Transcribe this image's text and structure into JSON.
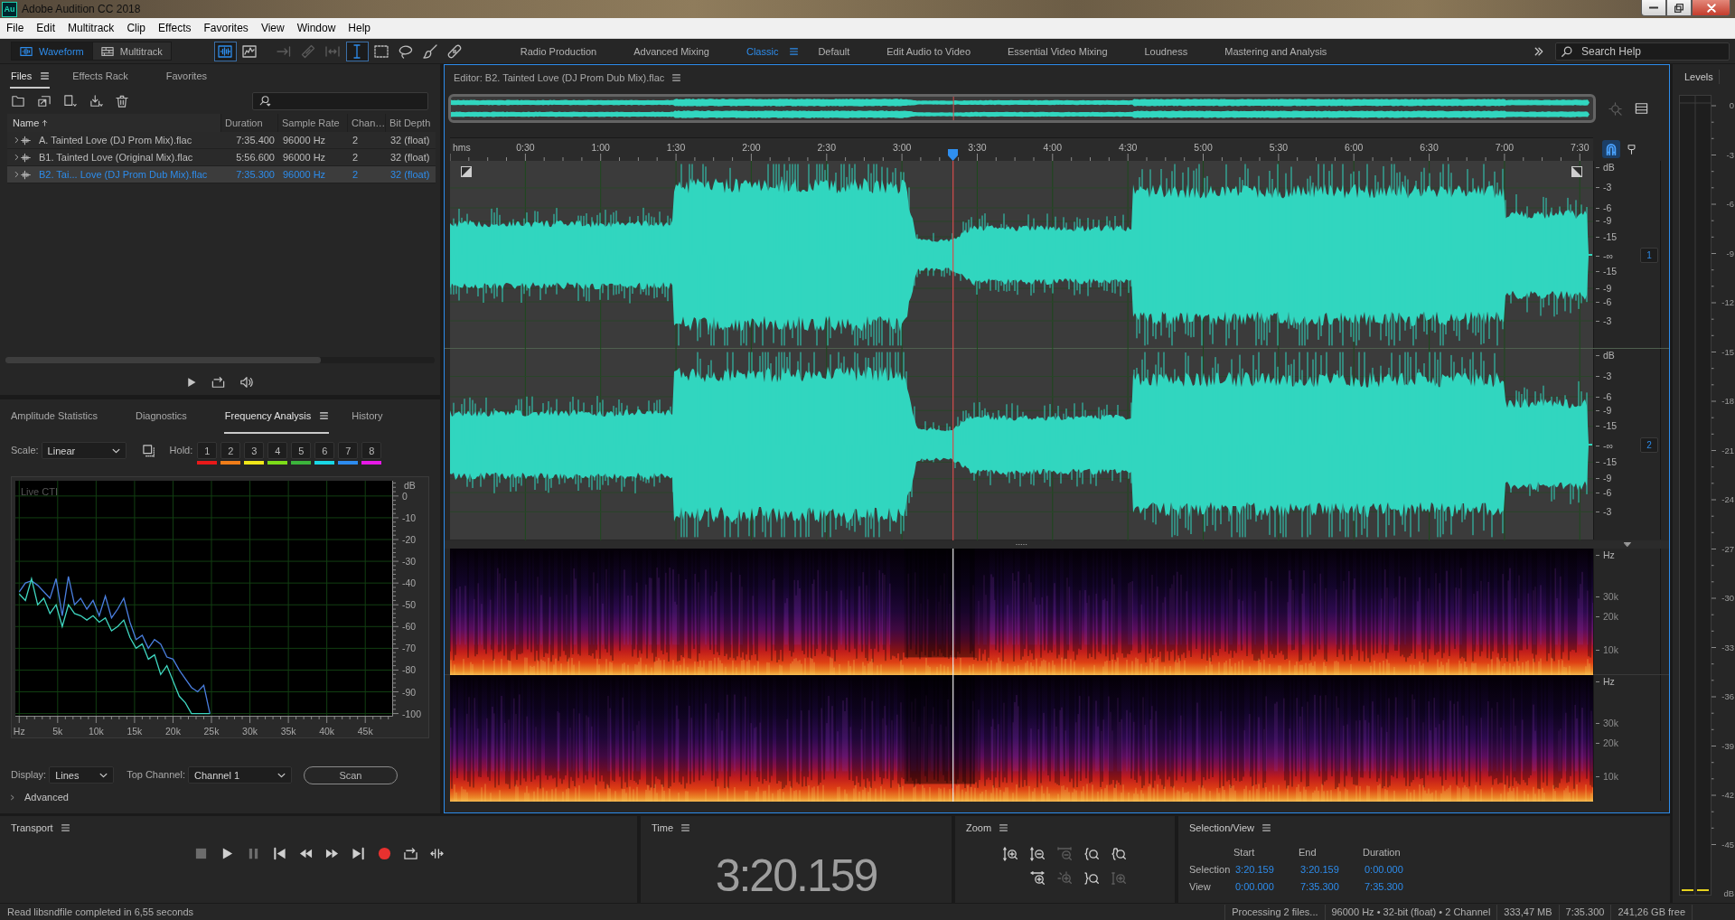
{
  "window": {
    "app_badge": "Au",
    "title": "Adobe Audition CC 2018"
  },
  "menu": [
    "File",
    "Edit",
    "Multitrack",
    "Clip",
    "Effects",
    "Favorites",
    "View",
    "Window",
    "Help"
  ],
  "toolbar": {
    "views": [
      {
        "kind": "waveform",
        "label": "Waveform",
        "selected": true
      },
      {
        "kind": "multitrack",
        "label": "Multitrack",
        "selected": false
      }
    ],
    "tools": [
      {
        "kind": "waveform-display",
        "selected": true,
        "disabled": false
      },
      {
        "kind": "spectral-display",
        "selected": false,
        "disabled": false
      },
      {
        "kind": "move",
        "selected": false,
        "disabled": true
      },
      {
        "kind": "razor",
        "selected": false,
        "disabled": true
      },
      {
        "kind": "slip",
        "selected": false,
        "disabled": true
      },
      {
        "kind": "time-selection",
        "selected": true,
        "disabled": false
      },
      {
        "kind": "marquee",
        "selected": false,
        "disabled": false
      },
      {
        "kind": "lasso",
        "selected": false,
        "disabled": false
      },
      {
        "kind": "brush",
        "selected": false,
        "disabled": false
      },
      {
        "kind": "spot-healing",
        "selected": false,
        "disabled": false
      }
    ],
    "workspaces": [
      {
        "label": "Radio Production",
        "selected": false
      },
      {
        "label": "Advanced Mixing",
        "selected": false
      },
      {
        "label": "Classic",
        "selected": true
      },
      {
        "label": "Default",
        "selected": false
      },
      {
        "label": "Edit Audio to Video",
        "selected": false
      },
      {
        "label": "Essential Video Mixing",
        "selected": false
      },
      {
        "label": "Loudness",
        "selected": false
      },
      {
        "label": "Mastering and Analysis",
        "selected": false
      }
    ],
    "search": {
      "placeholder": "Search Help"
    }
  },
  "files_panel": {
    "tabs": [
      {
        "label": "Files",
        "selected": true
      },
      {
        "label": "Effects Rack",
        "selected": false
      },
      {
        "label": "Favorites",
        "selected": false
      }
    ],
    "columns": [
      {
        "label": "Name",
        "sorted": true
      },
      {
        "label": "Duration",
        "sorted": false
      },
      {
        "label": "Sample Rate",
        "sorted": false
      },
      {
        "label": "Chan…",
        "sorted": false
      },
      {
        "label": "Bit Depth",
        "sorted": false
      }
    ],
    "rows": [
      {
        "name": "A. Tainted Love (DJ Prom Mix).flac",
        "duration": "7:35.400",
        "sample_rate": "96000 Hz",
        "channels": "2",
        "bit_depth": "32 (float)",
        "expanded": false,
        "selected": false
      },
      {
        "name": "B1. Tainted Love (Original Mix).flac",
        "duration": "5:56.600",
        "sample_rate": "96000 Hz",
        "channels": "2",
        "bit_depth": "32 (float)",
        "expanded": false,
        "selected": false
      },
      {
        "name": "B2. Tai... Love (DJ Prom Dub Mix).flac",
        "duration": "7:35.300",
        "sample_rate": "96000 Hz",
        "channels": "2",
        "bit_depth": "32 (float)",
        "expanded": false,
        "selected": true
      }
    ]
  },
  "analysis_panel": {
    "tabs": [
      {
        "label": "Amplitude Statistics",
        "selected": false
      },
      {
        "label": "Diagnostics",
        "selected": false
      },
      {
        "label": "Frequency Analysis",
        "selected": true
      },
      {
        "label": "History",
        "selected": false
      }
    ],
    "scale": {
      "label": "Scale:",
      "value": "Linear"
    },
    "hold": {
      "label": "Hold:",
      "slots": [
        {
          "label": "1",
          "color": "#e81919"
        },
        {
          "label": "2",
          "color": "#f07d19"
        },
        {
          "label": "3",
          "color": "#f0e619"
        },
        {
          "label": "4",
          "color": "#7ddc19"
        },
        {
          "label": "5",
          "color": "#3cb43c"
        },
        {
          "label": "6",
          "color": "#19d7e6"
        },
        {
          "label": "7",
          "color": "#2d8cf0"
        },
        {
          "label": "8",
          "color": "#e619e6"
        }
      ]
    },
    "chart_data": {
      "type": "line",
      "title": "Live CTI",
      "ylabel": "dB",
      "grid": true,
      "x": [
        0,
        800,
        1600,
        2400,
        3200,
        4000,
        4800,
        5600,
        6400,
        7200,
        8000,
        8800,
        9600,
        10400,
        11200,
        12000,
        12800,
        13600,
        14400,
        15200,
        16000,
        16800,
        17600,
        18400,
        19200,
        20000,
        20800,
        21600,
        22400,
        23200,
        24000,
        24800
      ],
      "series": [
        {
          "color": "#4a7fe0",
          "values": [
            -44,
            -40,
            -39,
            -41,
            -44,
            -47,
            -38,
            -55,
            -37,
            -50,
            -47,
            -52,
            -48,
            -55,
            -46,
            -56,
            -52,
            -47,
            -58,
            -66,
            -64,
            -70,
            -66,
            -68,
            -74,
            -75,
            -80,
            -84,
            -88,
            -90,
            -87,
            -100
          ]
        },
        {
          "color": "#3fd6c0",
          "values": [
            -45,
            -48,
            -38,
            -50,
            -47,
            -54,
            -50,
            -60,
            -50,
            -54,
            -55,
            -57,
            -55,
            -58,
            -56,
            -62,
            -60,
            -57,
            -65,
            -70,
            -68,
            -75,
            -73,
            -82,
            -78,
            -85,
            -92,
            -95,
            -100,
            -100,
            -100,
            -100
          ]
        }
      ],
      "xlim": [
        -500,
        48500
      ],
      "ylim": [
        -101,
        7
      ],
      "xticks": [
        {
          "value": 0,
          "label": "Hz"
        },
        {
          "value": 5000,
          "label": "5k"
        },
        {
          "value": 10000,
          "label": "10k"
        },
        {
          "value": 15000,
          "label": "15k"
        },
        {
          "value": 20000,
          "label": "20k"
        },
        {
          "value": 25000,
          "label": "25k"
        },
        {
          "value": 30000,
          "label": "30k"
        },
        {
          "value": 35000,
          "label": "35k"
        },
        {
          "value": 40000,
          "label": "40k"
        },
        {
          "value": 45000,
          "label": "45k"
        }
      ],
      "yticks": [
        0,
        -10,
        -20,
        -30,
        -40,
        -50,
        -60,
        -70,
        -80,
        -90,
        -100
      ]
    },
    "display": {
      "label": "Display:",
      "value": "Lines"
    },
    "top_channel": {
      "label": "Top Channel:",
      "value": "Channel 1"
    },
    "scan_button": "Scan",
    "advanced": {
      "label": "Advanced",
      "expanded": false
    }
  },
  "editor": {
    "title": "Editor: B2. Tainted Love (DJ Prom Dub Mix).flac",
    "cti": {
      "level": 0.4396
    },
    "snapping": true,
    "ruler": {
      "unit": "hms",
      "ticks": [
        "0:30",
        "1:00",
        "1:30",
        "2:00",
        "2:30",
        "3:00",
        "3:30",
        "4:00",
        "4:30",
        "5:00",
        "5:30",
        "6:00",
        "6:30",
        "7:00",
        "7:30"
      ]
    },
    "channels": [
      {
        "badge": "1",
        "scale": [
          "dB",
          "-3",
          "-6",
          "-9",
          "-15",
          "-∞",
          "-15",
          "-9",
          "-6",
          "-3"
        ]
      },
      {
        "badge": "2",
        "scale": [
          "dB",
          "-3",
          "-6",
          "-9",
          "-15",
          "-∞",
          "-15",
          "-9",
          "-6",
          "-3"
        ]
      }
    ],
    "spectral_channels": [
      {
        "scale": [
          "Hz",
          "30k",
          "20k",
          "10k"
        ]
      },
      {
        "scale": [
          "Hz",
          "30k",
          "20k",
          "10k"
        ]
      }
    ]
  },
  "levels": {
    "title": "Levels",
    "scale": [
      "0",
      "-3",
      "-6",
      "-9",
      "-12",
      "-15",
      "-18",
      "-21",
      "-24",
      "-27",
      "-30",
      "-33",
      "-36",
      "-39",
      "-42",
      "-45",
      "dB"
    ]
  },
  "transport": {
    "title": "Transport",
    "buttons": [
      {
        "kind": "stop",
        "disabled": true
      },
      {
        "kind": "play",
        "disabled": false
      },
      {
        "kind": "pause",
        "disabled": true
      },
      {
        "kind": "go-to-start",
        "disabled": false
      },
      {
        "kind": "rewind",
        "disabled": false
      },
      {
        "kind": "fast-forward",
        "disabled": false
      },
      {
        "kind": "go-to-end",
        "disabled": false
      },
      {
        "kind": "record",
        "disabled": false
      },
      {
        "kind": "loop",
        "disabled": false
      },
      {
        "kind": "skip-selection",
        "disabled": false
      }
    ]
  },
  "time": {
    "title": "Time",
    "value": "3:20.159"
  },
  "zoom": {
    "title": "Zoom",
    "buttons": [
      {
        "kind": "amplitude-in",
        "disabled": false
      },
      {
        "kind": "amplitude-out",
        "disabled": false
      },
      {
        "kind": "out-full",
        "disabled": true
      },
      {
        "kind": "in-at-in-point",
        "disabled": false
      },
      {
        "kind": "selection",
        "disabled": false
      },
      {
        "kind": "time-in",
        "disabled": false
      },
      {
        "kind": "center",
        "disabled": true
      },
      {
        "kind": "in-at-out-point",
        "disabled": false
      },
      {
        "kind": "amplitude-selection",
        "disabled": true
      }
    ]
  },
  "selection_view": {
    "title": "Selection/View",
    "columns": [
      "Start",
      "End",
      "Duration"
    ],
    "rows": [
      {
        "label": "Selection",
        "values": [
          "3:20.159",
          "3:20.159",
          "0:00.000"
        ]
      },
      {
        "label": "View",
        "values": [
          "0:00.000",
          "7:35.300",
          "7:35.300"
        ]
      }
    ]
  },
  "status_bar": {
    "message": "Read libsndfile completed in 6,55 seconds",
    "items": [
      "Processing 2 files...",
      "96000 Hz • 32-bit (float) • 2 Channel",
      "333,47 MB",
      "7:35.300",
      "241,26 GB free"
    ]
  }
}
